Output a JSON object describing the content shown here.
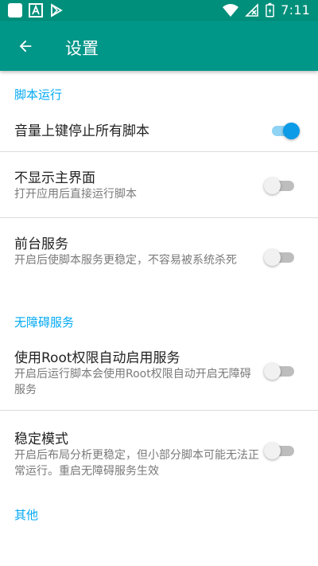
{
  "status_bar": {
    "time": "7:11",
    "left_icons": [
      "app-square-icon",
      "font-a-icon",
      "play-store-icon"
    ],
    "right_icons": [
      "wifi-icon",
      "no-signal-icon",
      "battery-charging-icon"
    ]
  },
  "app_bar": {
    "title": "设置",
    "back_icon": "arrow-left-icon",
    "background": "#009688"
  },
  "sections": {
    "script_run": {
      "title": "脚本运行"
    },
    "accessibility": {
      "title": "无障碍服务"
    },
    "other": {
      "title": "其他"
    }
  },
  "settings": {
    "volume_stop": {
      "title": "音量上键停止所有脚本",
      "enabled": true
    },
    "hide_main": {
      "title": "不显示主界面",
      "subtitle": "打开应用后直接运行脚本",
      "enabled": false
    },
    "foreground_service": {
      "title": "前台服务",
      "subtitle": "开启后使脚本服务更稳定，不容易被系统杀死",
      "enabled": false
    },
    "root_auto": {
      "title": "使用Root权限自动启用服务",
      "subtitle": "开启后运行脚本会使用Root权限自动开启无障碍服务",
      "enabled": false
    },
    "stable_mode": {
      "title": "稳定模式",
      "subtitle": "开启后布局分析更稳定，但小部分脚本可能无法正常运行。重启无障碍服务生效",
      "enabled": false
    }
  },
  "colors": {
    "accent": "#03a9f4",
    "switch_on": "#0b9be7",
    "status_bar": "#008f7a"
  }
}
